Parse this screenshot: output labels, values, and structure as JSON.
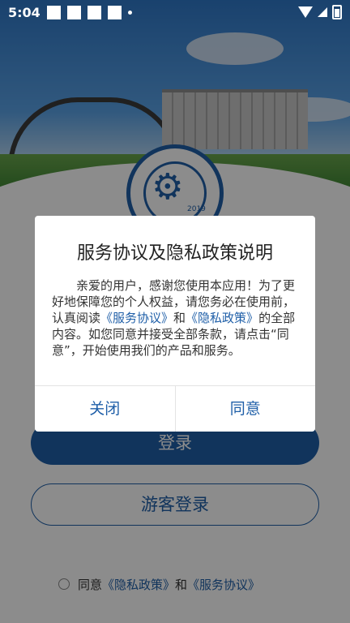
{
  "status_bar": {
    "time": "5:04",
    "icons": [
      "notification-square",
      "notification-square",
      "notification-square",
      "notification-square",
      "dot",
      "wifi-icon",
      "signal-icon",
      "battery-icon"
    ]
  },
  "background": {
    "login_button": "登录",
    "guest_button": "游客登录",
    "agreement": {
      "prefix": "同意",
      "privacy_link": "《隐私政策》",
      "and": "和",
      "service_link": "《服务协议》"
    }
  },
  "dialog": {
    "title": "服务协议及隐私政策说明",
    "body": {
      "part1": "亲爱的用户，感谢您使用本应用！为了更好地保障您的个人权益，请您务必在使用前，认真阅读",
      "link1": "《服务协议》",
      "and": "和",
      "link2": "《隐私政策》",
      "part2": "的全部内容。如您同意并接受全部条款，请点击“同意”，开始使用我们的产品和服务。"
    },
    "close_button": "关闭",
    "agree_button": "同意"
  },
  "colors": {
    "accent": "#1f5fa8",
    "overlay": "rgba(0,0,0,0.45)"
  }
}
